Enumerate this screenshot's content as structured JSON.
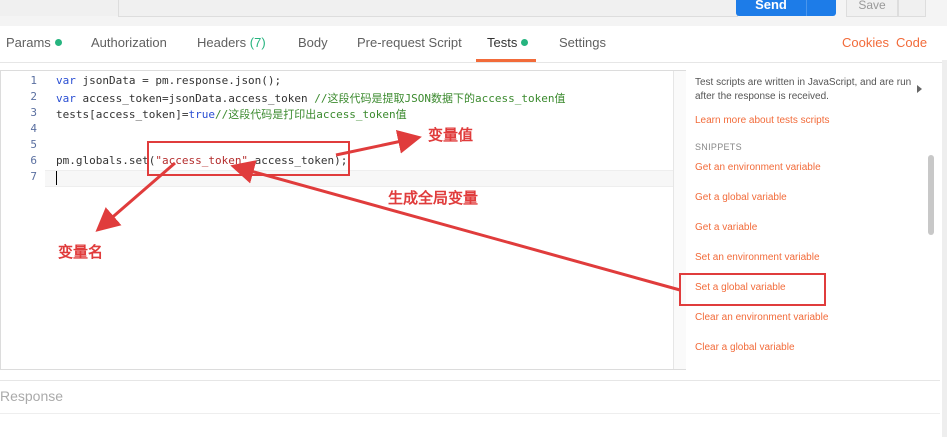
{
  "tabs": [
    {
      "label": "Params",
      "dot": true
    },
    {
      "label": "Authorization"
    },
    {
      "label": "Headers",
      "count": "(7)"
    },
    {
      "label": "Body"
    },
    {
      "label": "Pre-request Script"
    },
    {
      "label": "Tests",
      "dot": true,
      "active": true
    },
    {
      "label": "Settings"
    }
  ],
  "right_links": {
    "cookies": "Cookies",
    "code": "Code"
  },
  "toolbar": {
    "send_label": "Send",
    "save_label": "Save"
  },
  "editor": {
    "line_numbers": [
      "1",
      "2",
      "3",
      "4",
      "5",
      "6",
      "7"
    ],
    "line1": {
      "kw": "var",
      "rest": " jsonData = pm.response.json();"
    },
    "line2": {
      "kw": "var",
      "rest": " access_token=jsonData.access_token ",
      "comment": "//这段代码是提取JSON数据下的access_token值"
    },
    "line3": {
      "pre": "tests[access_token]=",
      "kw": "true",
      "comment": "//这段代码是打印出access_token值"
    },
    "line6": {
      "pre": "pm.globals.set(",
      "str": "\"access_token\"",
      "post": ",access_token);"
    }
  },
  "sidebar": {
    "description": "Test scripts are written in JavaScript, and are run after the response is received.",
    "learn_more": "Learn more about tests scripts",
    "snippets_title": "SNIPPETS",
    "snippets": [
      "Get an environment variable",
      "Get a global variable",
      "Get a variable",
      "Set an environment variable",
      "Set a global variable",
      "Clear an environment variable",
      "Clear a global variable"
    ]
  },
  "response_label": "Response",
  "annotations": {
    "value_label": "变量值",
    "global_label": "生成全局变量",
    "name_label": "变量名",
    "color": "#e03c3c"
  },
  "colors": {
    "accent": "#f26b3a",
    "send": "#1d7ce8",
    "active_dot": "#26b47f"
  }
}
